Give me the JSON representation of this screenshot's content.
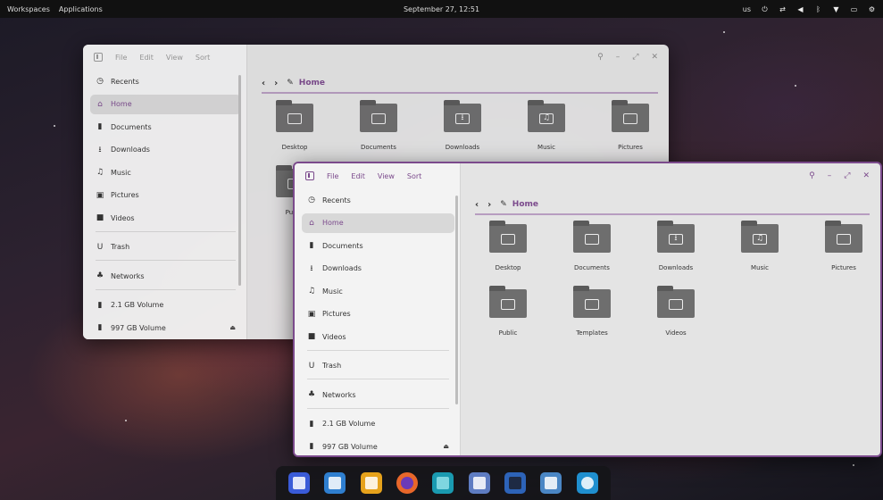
{
  "top_panel": {
    "workspaces": "Workspaces",
    "applications": "Applications",
    "clock": "September 27, 12:51",
    "keyboard_layout": "us",
    "tray_icons": [
      "power-icon",
      "network-wired-icon",
      "volume-icon",
      "bluetooth-icon",
      "wifi-icon",
      "battery-icon",
      "settings-icon"
    ]
  },
  "back_window": {
    "menu": [
      "File",
      "Edit",
      "View",
      "Sort"
    ],
    "sidebar": [
      {
        "label": "Recents",
        "icon": "clock-icon",
        "glyph": "◷"
      },
      {
        "label": "Home",
        "icon": "home-icon",
        "glyph": "⌂",
        "active": true
      },
      {
        "label": "Documents",
        "icon": "document-icon",
        "glyph": "▮"
      },
      {
        "label": "Downloads",
        "icon": "download-icon",
        "glyph": "⭳"
      },
      {
        "label": "Music",
        "icon": "music-icon",
        "glyph": "♫"
      },
      {
        "label": "Pictures",
        "icon": "picture-icon",
        "glyph": "▣"
      },
      {
        "label": "Videos",
        "icon": "video-icon",
        "glyph": "■"
      },
      {
        "label": "Trash",
        "icon": "trash-icon",
        "glyph": "U"
      },
      {
        "label": "Networks",
        "icon": "network-icon",
        "glyph": "♣"
      },
      {
        "label": "2.1 GB Volume",
        "icon": "drive-icon",
        "glyph": "▮"
      },
      {
        "label": "997 GB Volume",
        "icon": "drive-icon",
        "glyph": "▮"
      }
    ],
    "path": "Home",
    "files": [
      {
        "label": "Desktop",
        "icon": "desktop-folder-icon",
        "glyph": ""
      },
      {
        "label": "Documents",
        "icon": "documents-folder-icon",
        "glyph": ""
      },
      {
        "label": "Downloads",
        "icon": "downloads-folder-icon",
        "glyph": "⭳"
      },
      {
        "label": "Music",
        "icon": "music-folder-icon",
        "glyph": "♫"
      },
      {
        "label": "Pictures",
        "icon": "pictures-folder-icon",
        "glyph": ""
      },
      {
        "label": "Public",
        "icon": "public-folder-icon",
        "glyph": ""
      }
    ]
  },
  "front_window": {
    "menu": [
      "File",
      "Edit",
      "View",
      "Sort"
    ],
    "sidebar": [
      {
        "label": "Recents",
        "icon": "clock-icon",
        "glyph": "◷"
      },
      {
        "label": "Home",
        "icon": "home-icon",
        "glyph": "⌂",
        "active": true
      },
      {
        "label": "Documents",
        "icon": "document-icon",
        "glyph": "▮"
      },
      {
        "label": "Downloads",
        "icon": "download-icon",
        "glyph": "⭳"
      },
      {
        "label": "Music",
        "icon": "music-icon",
        "glyph": "♫"
      },
      {
        "label": "Pictures",
        "icon": "picture-icon",
        "glyph": "▣"
      },
      {
        "label": "Videos",
        "icon": "video-icon",
        "glyph": "■"
      },
      {
        "label": "Trash",
        "icon": "trash-icon",
        "glyph": "U"
      },
      {
        "label": "Networks",
        "icon": "network-icon",
        "glyph": "♣"
      },
      {
        "label": "2.1 GB Volume",
        "icon": "drive-icon",
        "glyph": "▮"
      },
      {
        "label": "997 GB Volume",
        "icon": "drive-icon",
        "glyph": "▮"
      }
    ],
    "path": "Home",
    "files": [
      {
        "label": "Desktop",
        "icon": "desktop-folder-icon",
        "glyph": ""
      },
      {
        "label": "Documents",
        "icon": "documents-folder-icon",
        "glyph": ""
      },
      {
        "label": "Downloads",
        "icon": "downloads-folder-icon",
        "glyph": "⭳"
      },
      {
        "label": "Music",
        "icon": "music-folder-icon",
        "glyph": "♫"
      },
      {
        "label": "Pictures",
        "icon": "pictures-folder-icon",
        "glyph": ""
      },
      {
        "label": "Public",
        "icon": "public-folder-icon",
        "glyph": ""
      },
      {
        "label": "Templates",
        "icon": "templates-folder-icon",
        "glyph": ""
      },
      {
        "label": "Videos",
        "icon": "videos-folder-icon",
        "glyph": ""
      }
    ]
  },
  "dock": [
    {
      "name": "search-app-icon",
      "color": "#3a5bd8"
    },
    {
      "name": "multitasking-app-icon",
      "color": "#2f7fd0"
    },
    {
      "name": "app-grid-icon",
      "color": "#e6a21c"
    },
    {
      "name": "firefox-icon",
      "color": "#e8672a"
    },
    {
      "name": "files-icon",
      "color": "#1a9ab0"
    },
    {
      "name": "text-editor-icon",
      "color": "#5e7cc2"
    },
    {
      "name": "terminal-icon",
      "color": "#2d63b8"
    },
    {
      "name": "software-store-icon",
      "color": "#4a86c4"
    },
    {
      "name": "settings-app-icon",
      "color": "#1f8fcf"
    }
  ],
  "colors": {
    "accent": "#7b4a8c",
    "window_bg": "#e4e4e4",
    "panel_bg": "#111111"
  }
}
